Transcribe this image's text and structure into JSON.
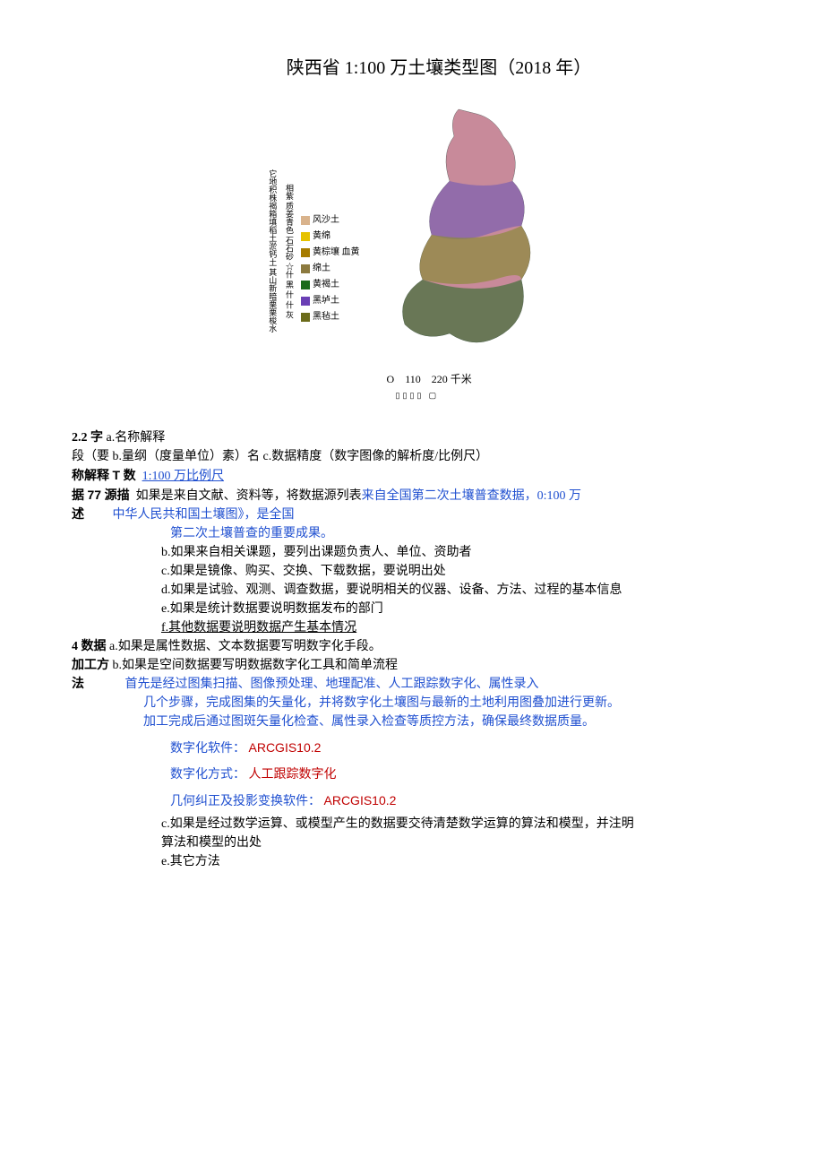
{
  "title": "陕西省 1:100 万土壤类型图（2018 年）",
  "chart_data": {
    "type": "map",
    "region": "陕西省",
    "legend": [
      {
        "color": "#d9b38c",
        "label": "风沙土"
      },
      {
        "color": "#e6c200",
        "label": "黄绵"
      },
      {
        "color": "#a67c00",
        "label": "黄棕壤 血黄"
      },
      {
        "color": "#8c7a3f",
        "label": "绵土"
      },
      {
        "color": "#1a6b1a",
        "label": "黄褐土"
      },
      {
        "color": "#6a3fb5",
        "label": "黑垆土"
      },
      {
        "color": "#6b6b1a",
        "label": "黑毡土"
      }
    ],
    "side_text_vertical": "它地积株褐箱填稻土淤钙土 其山新暗栗栗梭水",
    "side_text_vertical2": "相紫 质姜青色 石石砂 ☆什 黑 什 什 灰",
    "scale_values": [
      "O",
      "110",
      "220 千米"
    ]
  },
  "sections": {
    "s22": {
      "heading": "2.2 字",
      "line1a": "a.名称解释",
      "line2": "段（要 b.量纲（度量单位）素）名 c.数据精度（数字图像的解析度/比例尺）",
      "line3a": "称解释",
      "line3b": "T",
      "line3c": "数",
      "line3d": "1:100 万比例尺",
      "line4a": "据",
      "line4b": "77",
      "line4c": "源描",
      "line4d": "如果是来自文献、资料等，将数据源列表",
      "line4e": "来自全国第二次土壤普查数据，0:100 万",
      "line5a": "述",
      "line5b": "中华人民共和国土壤图》，是全国",
      "line6": "第二次土壤普查的重要成果。",
      "line7": "b.如果来自相关课题，要列出课题负责人、单位、资助者",
      "line8": "c.如果是镜像、购买、交换、下载数据，要说明出处",
      "line9": "d.如果是试验、观测、调查数据，要说明相关的仪器、设备、方法、过程的基本信息",
      "line10": "e.如果是统计数据要说明数据发布的部门",
      "line11": "f.其他数据要说明数据产生基本情况"
    },
    "s4": {
      "heading1": "4 数据",
      "heading1b": "a.如果是属性数据、文本数据要写明数字化手段。",
      "heading2": "加工方",
      "heading2b": "b.如果是空间数据要写明数据数字化工具和简单流程",
      "heading3": "法",
      "blue1": "首先是经过图集扫描、图像预处理、地理配准、人工跟踪数字化、属性录入",
      "blue2": "几个步骤，完成图集的矢量化，并将数字化土壤图与最新的土地利用图叠加进行更新。",
      "blue3": "加工完成后通过图斑矢量化检查、属性录入检查等质控方法，确保最终数据质量。",
      "blue4a": "数字化软件：",
      "blue4b": "ARCGIS10.2",
      "blue5a": "数字化方式：",
      "blue5b": "人工跟踪数字化",
      "blue6a": "几何纠正及投影变换软件：",
      "blue6b": "ARCGIS10.2",
      "line_c": "c.如果是经过数学运算、或模型产生的数据要交待清楚数学运算的算法和模型，并注明",
      "line_c2": "算法和模型的出处",
      "line_e": "e.其它方法"
    }
  }
}
